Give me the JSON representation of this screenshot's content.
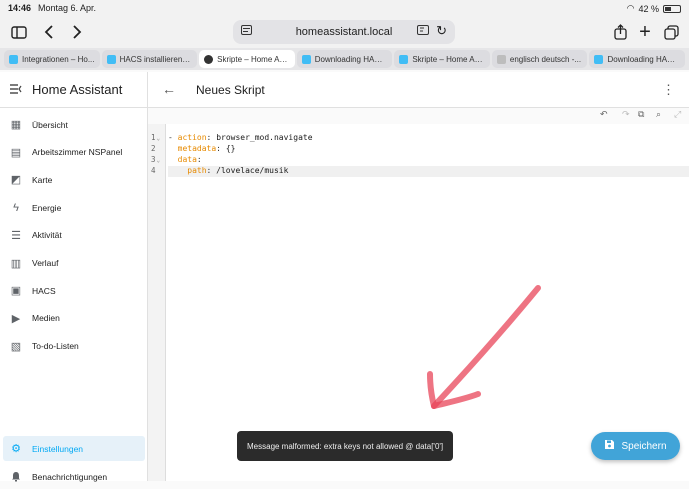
{
  "statusbar": {
    "time": "14:46",
    "date": "Montag 6. Apr.",
    "battery": "42 %",
    "battery_level": 0.42
  },
  "browser": {
    "url": "homeassistant.local",
    "tabs": [
      {
        "title": "Integrationen – Ho...",
        "icon": "home-assistant-icon",
        "active": false
      },
      {
        "title": "HACS installieren –...",
        "icon": "hacs-icon",
        "active": false
      },
      {
        "title": "Skripte – Home As...",
        "icon": "close-icon",
        "active": true
      },
      {
        "title": "Downloading HACS...",
        "icon": "home-assistant-icon",
        "active": false
      },
      {
        "title": "Skripte – Home As...",
        "icon": "home-assistant-icon",
        "active": false
      },
      {
        "title": "englisch deutsch -...",
        "icon": "generic-page-icon",
        "active": false
      },
      {
        "title": "Downloading HACS...",
        "icon": "home-assistant-icon",
        "active": false
      }
    ]
  },
  "sidebar": {
    "title": "Home Assistant",
    "items": [
      {
        "label": "Übersicht",
        "icon": "dashboard-icon"
      },
      {
        "label": "Arbeitszimmer NSPanel",
        "icon": "panel-icon"
      },
      {
        "label": "Karte",
        "icon": "map-icon"
      },
      {
        "label": "Energie",
        "icon": "lightning-icon"
      },
      {
        "label": "Aktivität",
        "icon": "list-icon"
      },
      {
        "label": "Verlauf",
        "icon": "chart-icon"
      },
      {
        "label": "HACS",
        "icon": "hacs-icon"
      },
      {
        "label": "Medien",
        "icon": "media-icon"
      },
      {
        "label": "To-do-Listen",
        "icon": "clipboard-icon"
      }
    ],
    "settings_label": "Einstellungen",
    "notifications_label": "Benachrichtigungen"
  },
  "header": {
    "title": "Neues Skript"
  },
  "editor": {
    "line_numbers": [
      "1",
      "2",
      "3",
      "4"
    ],
    "lines": [
      {
        "indent": "",
        "prefix": "- ",
        "key": "action",
        "sep": ": ",
        "value": "browser_mod.navigate"
      },
      {
        "indent": "  ",
        "prefix": "",
        "key": "metadata",
        "sep": ": ",
        "value": "{}"
      },
      {
        "indent": "  ",
        "prefix": "",
        "key": "data",
        "sep": ":",
        "value": ""
      },
      {
        "indent": "    ",
        "prefix": "",
        "key": "path",
        "sep": ": ",
        "value": "/lovelace/musik"
      }
    ]
  },
  "toast": {
    "message": "Message malformed: extra keys not allowed @ data['0']"
  },
  "save_button": {
    "label": "Speichern"
  },
  "colors": {
    "accent": "#03a9f4",
    "save": "#41a4d8",
    "yaml_key": "#e78a00",
    "arrow": "#e8455a"
  }
}
